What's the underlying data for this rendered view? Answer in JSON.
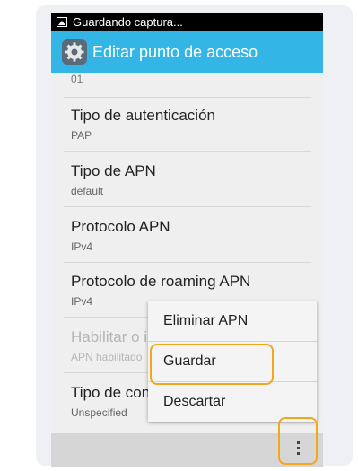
{
  "status_bar": {
    "text": "Guardando captura...",
    "icon": "image-icon"
  },
  "action_bar": {
    "title": "Editar punto de acceso",
    "icon": "settings-gear-icon"
  },
  "list": {
    "partial_value": "01",
    "items": [
      {
        "title": "Tipo de autenticación",
        "value": "PAP"
      },
      {
        "title": "Tipo de APN",
        "value": "default"
      },
      {
        "title": "Protocolo APN",
        "value": "IPv4"
      },
      {
        "title": "Protocolo de roaming APN",
        "value": "IPv4"
      },
      {
        "title": "Habilitar o i",
        "value": "APN habilitado"
      },
      {
        "title": "Tipo de con",
        "value": "Unspecified"
      }
    ]
  },
  "menu": {
    "items": [
      "Eliminar APN",
      "Guardar",
      "Descartar"
    ]
  },
  "bottom_bar": {
    "overflow_icon": "more-vertical-icon"
  },
  "colors": {
    "action_bar": "#33b5e5",
    "highlight": "#f2a81a"
  }
}
